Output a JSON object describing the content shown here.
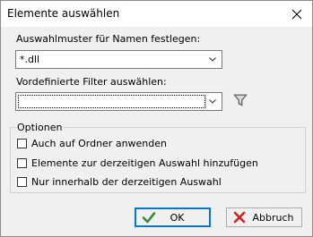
{
  "dialog": {
    "title": "Elemente auswählen",
    "pattern_label": "Auswahlmuster für Namen festlegen:",
    "pattern_value": "*.dll",
    "filter_label": "Vordefinierte Filter auswählen:",
    "filter_value": "",
    "options_legend": "Optionen",
    "options": [
      {
        "label": "Auch auf Ordner anwenden",
        "checked": false
      },
      {
        "label": "Elemente zur derzeitigen Auswahl hinzufügen",
        "checked": false
      },
      {
        "label": "Nur innerhalb der derzeitigen Auswahl",
        "checked": false
      }
    ],
    "ok_label": "OK",
    "cancel_label": "Abbruch"
  },
  "icons": {
    "close": "close-icon",
    "dropdown": "chevron-down-icon",
    "filter": "funnel-icon",
    "ok": "checkmark-icon",
    "cancel": "x-icon"
  },
  "colors": {
    "ok_icon": "#2e8b2e",
    "cancel_icon": "#d42020",
    "focus_border": "#0078d7"
  }
}
